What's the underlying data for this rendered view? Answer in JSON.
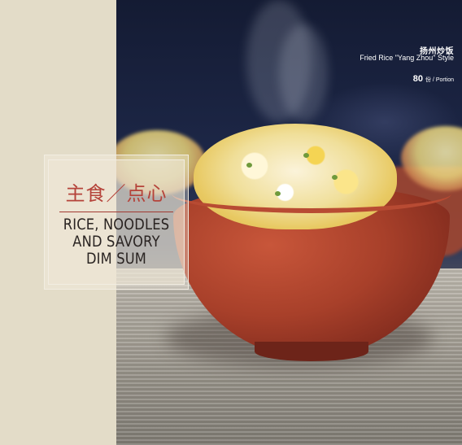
{
  "section": {
    "title_cn": "主食／点心",
    "title_en_lines": [
      "RICE, NOODLES",
      "AND SAVORY",
      "DIM SUM"
    ]
  },
  "dish": {
    "name_cn": "扬州炒饭",
    "name_en": "Fried Rice \"Yang Zhou\" Style",
    "price": "80",
    "price_unit": "份 / Portion"
  },
  "colors": {
    "panel_bg": "#e3dcc8",
    "accent_red": "#b5433a",
    "bowl_red": "#a8402a",
    "text_dark": "#2a2422"
  }
}
